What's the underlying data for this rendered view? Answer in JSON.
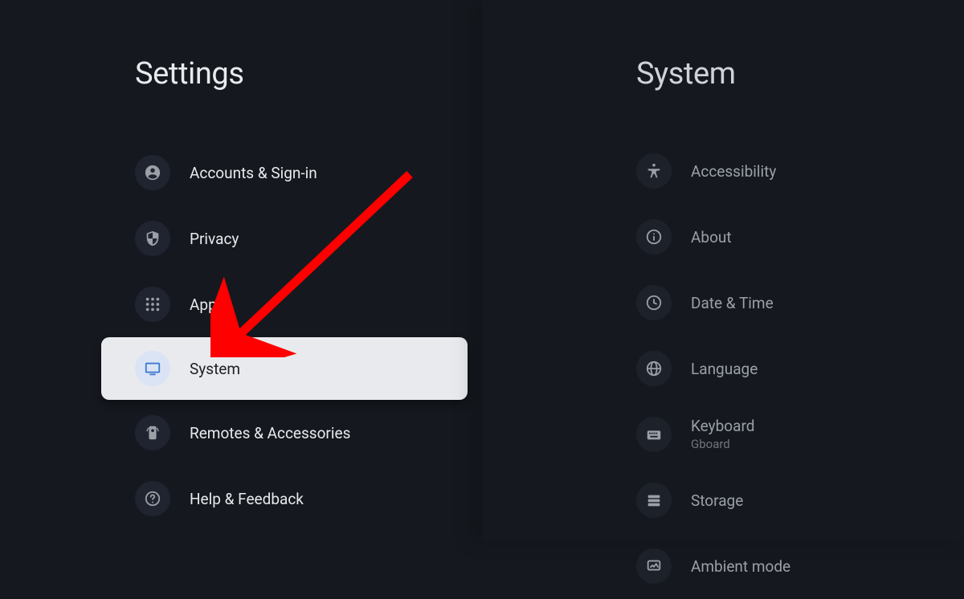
{
  "left": {
    "title": "Settings",
    "items": [
      {
        "label": "Accounts & Sign-in"
      },
      {
        "label": "Privacy"
      },
      {
        "label": "Apps"
      },
      {
        "label": "System"
      },
      {
        "label": "Remotes & Accessories"
      },
      {
        "label": "Help & Feedback"
      }
    ],
    "selected_index": 3
  },
  "right": {
    "title": "System",
    "items": [
      {
        "label": "Accessibility"
      },
      {
        "label": "About"
      },
      {
        "label": "Date & Time"
      },
      {
        "label": "Language"
      },
      {
        "label": "Keyboard",
        "sub": "Gboard"
      },
      {
        "label": "Storage"
      },
      {
        "label": "Ambient mode"
      }
    ]
  }
}
